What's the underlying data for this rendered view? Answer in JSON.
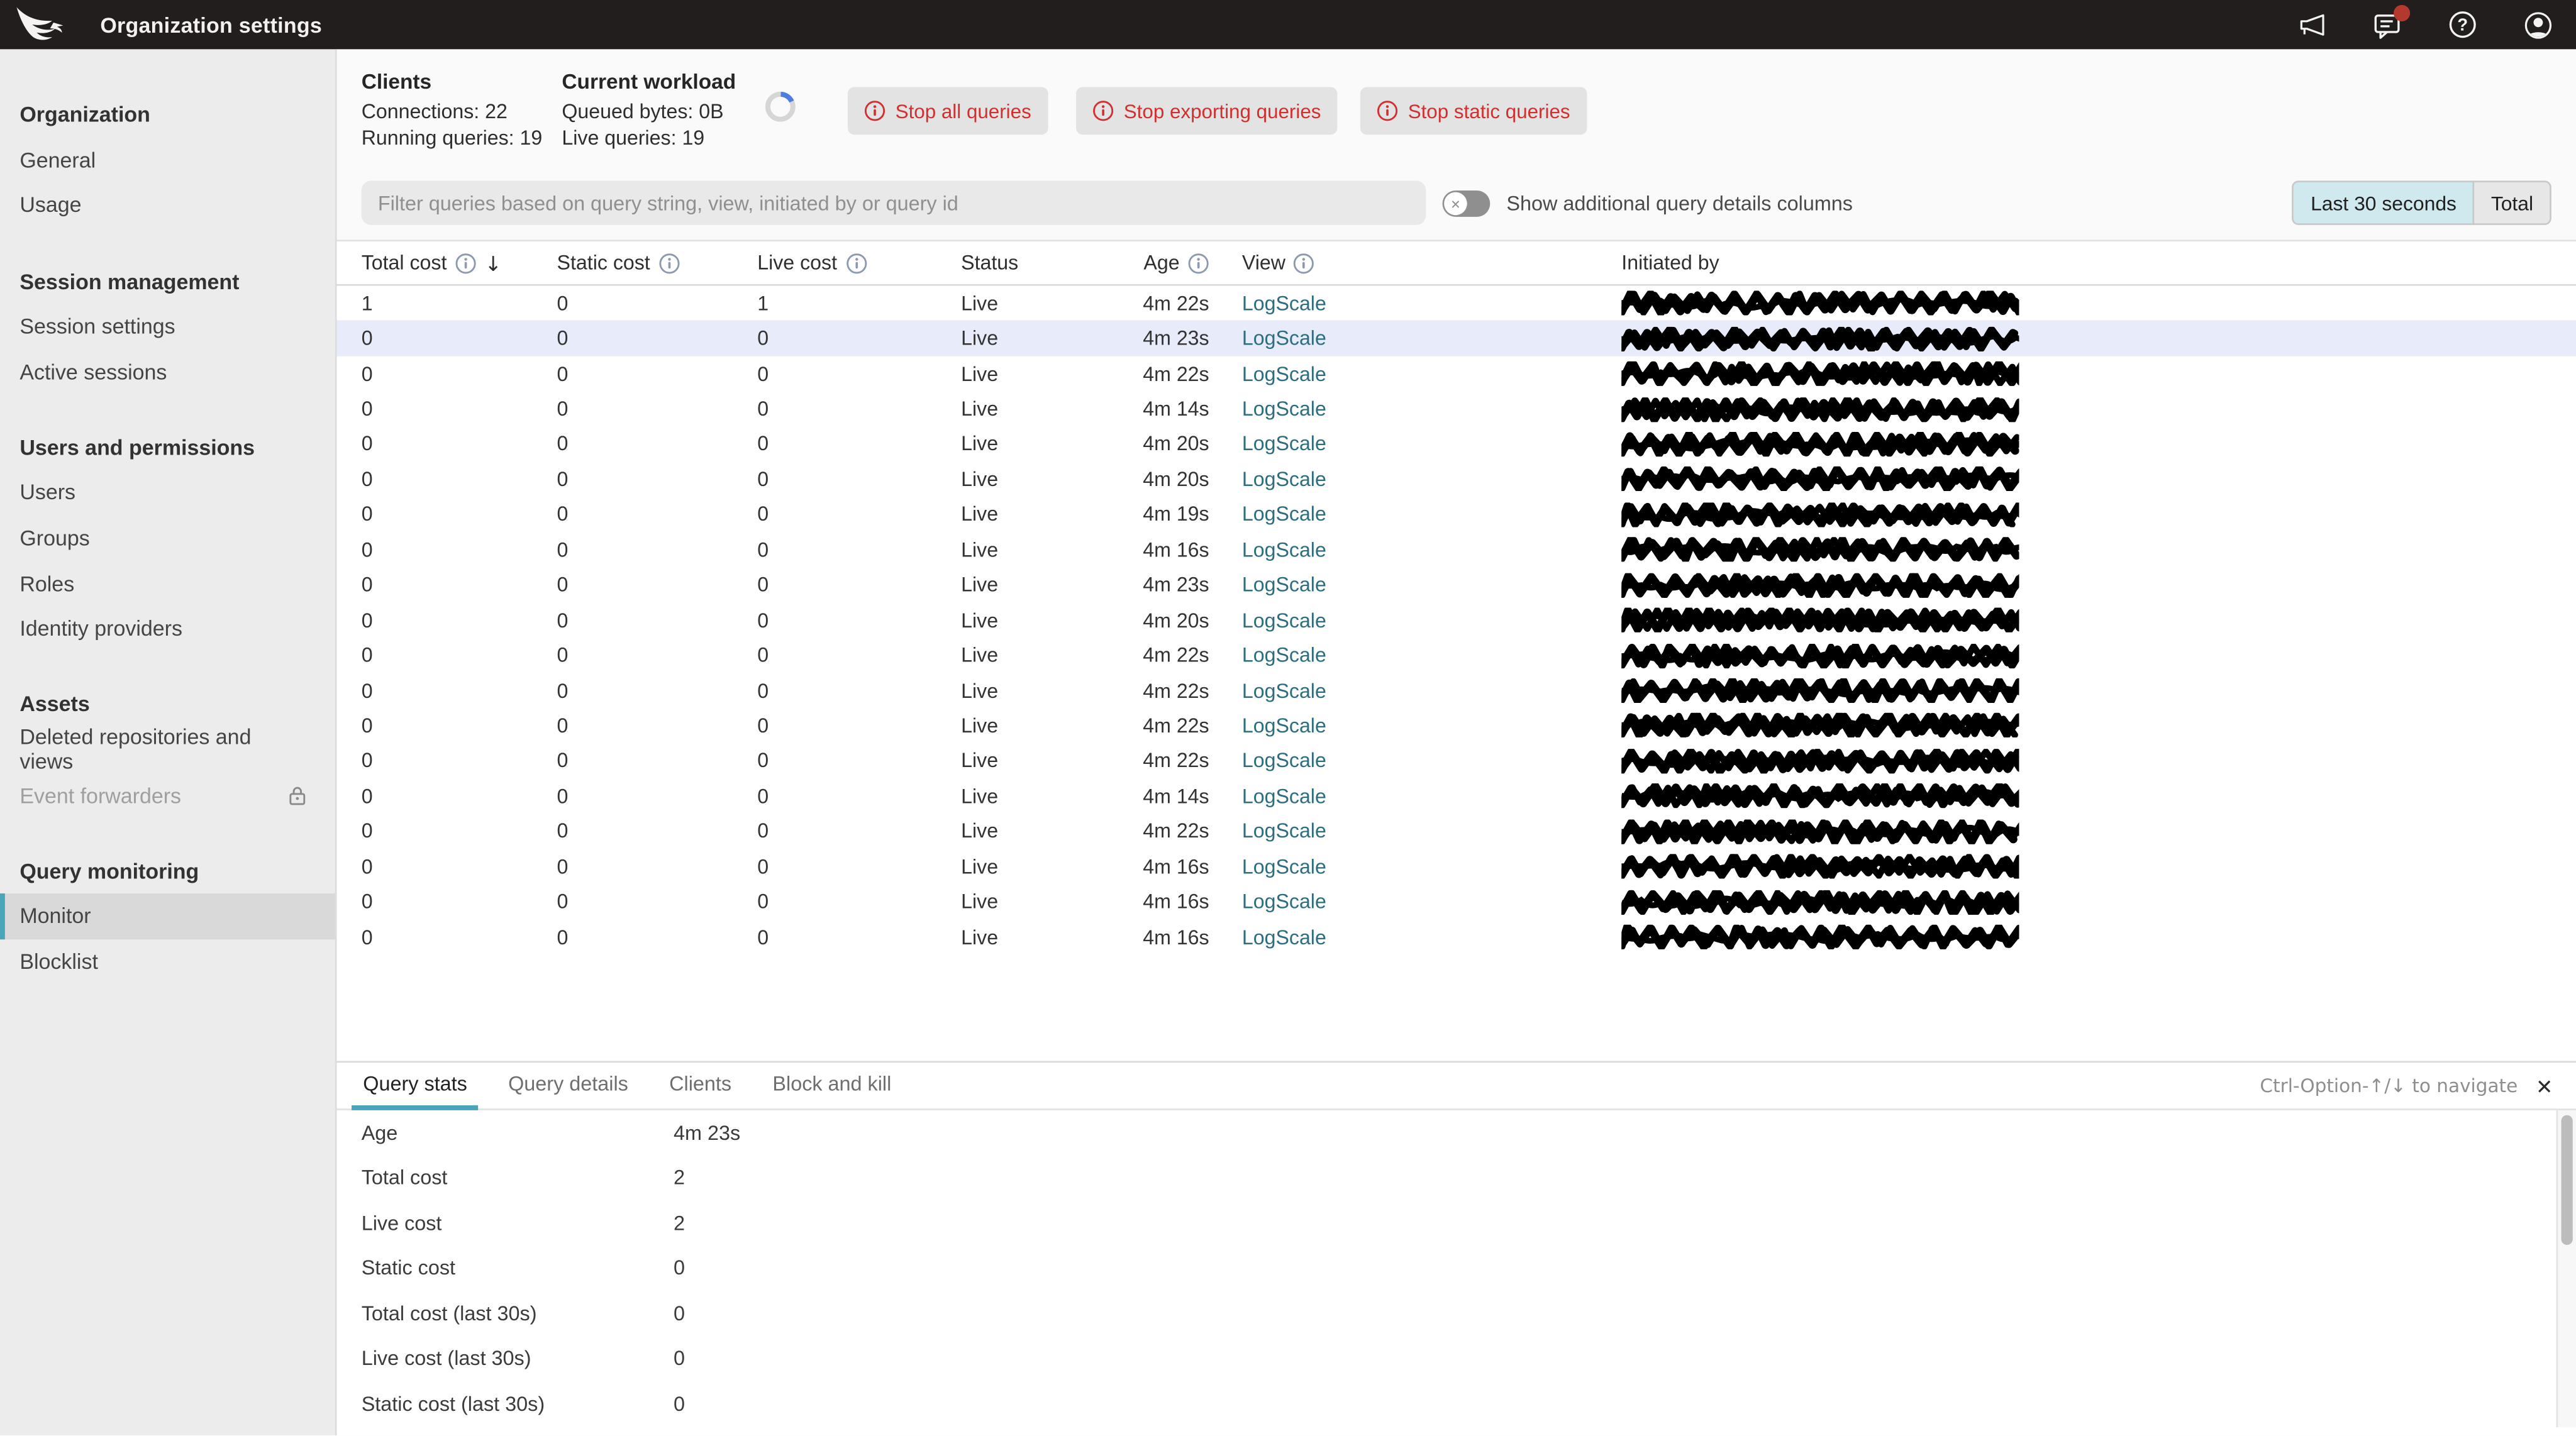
{
  "topbar": {
    "title": "Organization settings",
    "icons": [
      "announcements-icon",
      "notifications-icon",
      "help-icon",
      "user-avatar-icon"
    ],
    "notification_badge": true
  },
  "sidebar": {
    "sections": [
      {
        "heading": "Organization",
        "items": [
          {
            "label": "General"
          },
          {
            "label": "Usage"
          }
        ]
      },
      {
        "heading": "Session management",
        "items": [
          {
            "label": "Session settings"
          },
          {
            "label": "Active sessions"
          }
        ]
      },
      {
        "heading": "Users and permissions",
        "items": [
          {
            "label": "Users"
          },
          {
            "label": "Groups"
          },
          {
            "label": "Roles"
          },
          {
            "label": "Identity providers"
          }
        ]
      },
      {
        "heading": "Assets",
        "items": [
          {
            "label": "Deleted repositories and views"
          },
          {
            "label": "Event forwarders",
            "disabled": true,
            "lock_icon": true
          }
        ]
      },
      {
        "heading": "Query monitoring",
        "items": [
          {
            "label": "Monitor",
            "active": true
          },
          {
            "label": "Blocklist"
          }
        ]
      }
    ]
  },
  "workload": {
    "clients_heading": "Clients",
    "connections": "Connections: 22",
    "running_queries": "Running queries: 19",
    "workload_heading": "Current workload",
    "queued_bytes": "Queued bytes: 0B",
    "live_queries": "Live queries: 19",
    "spinner": true
  },
  "actions": {
    "buttons": [
      {
        "label": "Stop all queries",
        "icon": "info-icon"
      },
      {
        "label": "Stop exporting queries",
        "icon": "info-icon"
      },
      {
        "label": "Stop static queries",
        "icon": "info-icon"
      }
    ]
  },
  "filter": {
    "placeholder": "Filter queries based on query string, view, initiated by or query id",
    "toggle_label": "Show additional query details columns",
    "toggle_state": "off",
    "range_buttons": [
      {
        "label": "Last 30 seconds",
        "active": true
      },
      {
        "label": "Total",
        "active": false
      }
    ]
  },
  "table": {
    "columns": [
      {
        "label": "Total cost",
        "info": true,
        "sorted": "desc"
      },
      {
        "label": "Static cost",
        "info": true
      },
      {
        "label": "Live cost",
        "info": true
      },
      {
        "label": "Status"
      },
      {
        "label": "Age",
        "info": true,
        "align": "right"
      },
      {
        "label": "View",
        "info": true
      },
      {
        "label": "Initiated by"
      }
    ],
    "selected_row_index": 1,
    "rows": [
      {
        "total_cost": "1",
        "static_cost": "0",
        "live_cost": "1",
        "status": "Live",
        "age": "4m 22s",
        "view": "LogScale",
        "initiated_by_redacted": true
      },
      {
        "total_cost": "0",
        "static_cost": "0",
        "live_cost": "0",
        "status": "Live",
        "age": "4m 23s",
        "view": "LogScale",
        "initiated_by_redacted": true
      },
      {
        "total_cost": "0",
        "static_cost": "0",
        "live_cost": "0",
        "status": "Live",
        "age": "4m 22s",
        "view": "LogScale",
        "initiated_by_redacted": true
      },
      {
        "total_cost": "0",
        "static_cost": "0",
        "live_cost": "0",
        "status": "Live",
        "age": "4m 14s",
        "view": "LogScale",
        "initiated_by_redacted": true
      },
      {
        "total_cost": "0",
        "static_cost": "0",
        "live_cost": "0",
        "status": "Live",
        "age": "4m 20s",
        "view": "LogScale",
        "initiated_by_redacted": true
      },
      {
        "total_cost": "0",
        "static_cost": "0",
        "live_cost": "0",
        "status": "Live",
        "age": "4m 20s",
        "view": "LogScale",
        "initiated_by_redacted": true
      },
      {
        "total_cost": "0",
        "static_cost": "0",
        "live_cost": "0",
        "status": "Live",
        "age": "4m 19s",
        "view": "LogScale",
        "initiated_by_redacted": true
      },
      {
        "total_cost": "0",
        "static_cost": "0",
        "live_cost": "0",
        "status": "Live",
        "age": "4m 16s",
        "view": "LogScale",
        "initiated_by_redacted": true
      },
      {
        "total_cost": "0",
        "static_cost": "0",
        "live_cost": "0",
        "status": "Live",
        "age": "4m 23s",
        "view": "LogScale",
        "initiated_by_redacted": true
      },
      {
        "total_cost": "0",
        "static_cost": "0",
        "live_cost": "0",
        "status": "Live",
        "age": "4m 20s",
        "view": "LogScale",
        "initiated_by_redacted": true
      },
      {
        "total_cost": "0",
        "static_cost": "0",
        "live_cost": "0",
        "status": "Live",
        "age": "4m 22s",
        "view": "LogScale",
        "initiated_by_redacted": true
      },
      {
        "total_cost": "0",
        "static_cost": "0",
        "live_cost": "0",
        "status": "Live",
        "age": "4m 22s",
        "view": "LogScale",
        "initiated_by_redacted": true
      },
      {
        "total_cost": "0",
        "static_cost": "0",
        "live_cost": "0",
        "status": "Live",
        "age": "4m 22s",
        "view": "LogScale",
        "initiated_by_redacted": true
      },
      {
        "total_cost": "0",
        "static_cost": "0",
        "live_cost": "0",
        "status": "Live",
        "age": "4m 22s",
        "view": "LogScale",
        "initiated_by_redacted": true
      },
      {
        "total_cost": "0",
        "static_cost": "0",
        "live_cost": "0",
        "status": "Live",
        "age": "4m 14s",
        "view": "LogScale",
        "initiated_by_redacted": true
      },
      {
        "total_cost": "0",
        "static_cost": "0",
        "live_cost": "0",
        "status": "Live",
        "age": "4m 22s",
        "view": "LogScale",
        "initiated_by_redacted": true
      },
      {
        "total_cost": "0",
        "static_cost": "0",
        "live_cost": "0",
        "status": "Live",
        "age": "4m 16s",
        "view": "LogScale",
        "initiated_by_redacted": true
      },
      {
        "total_cost": "0",
        "static_cost": "0",
        "live_cost": "0",
        "status": "Live",
        "age": "4m 16s",
        "view": "LogScale",
        "initiated_by_redacted": true
      },
      {
        "total_cost": "0",
        "static_cost": "0",
        "live_cost": "0",
        "status": "Live",
        "age": "4m 16s",
        "view": "LogScale",
        "initiated_by_redacted": true
      }
    ]
  },
  "details": {
    "tabs": [
      {
        "label": "Query stats",
        "active": true
      },
      {
        "label": "Query details"
      },
      {
        "label": "Clients"
      },
      {
        "label": "Block and kill"
      }
    ],
    "shortcut_hint": "Ctrl-Option-↑/↓ to navigate",
    "close_icon": "✕",
    "stats": [
      {
        "label": "Age",
        "value": "4m 23s"
      },
      {
        "label": "Total cost",
        "value": "2"
      },
      {
        "label": "Live cost",
        "value": "2"
      },
      {
        "label": "Static cost",
        "value": "0"
      },
      {
        "label": "Total cost (last 30s)",
        "value": "0"
      },
      {
        "label": "Live cost (last 30s)",
        "value": "0"
      },
      {
        "label": "Static cost (last 30s)",
        "value": "0"
      }
    ]
  },
  "colors": {
    "topbar_bg": "#211e1d",
    "accent_teal": "#4aa4ba",
    "danger_red": "#d22f2f",
    "link_teal": "#2c6e80",
    "selected_row_bg": "#e8ecfa",
    "active_segment_bg": "#cfe9ee",
    "notification_red": "#b4392c",
    "spinner_blue": "#4f7ce0"
  }
}
